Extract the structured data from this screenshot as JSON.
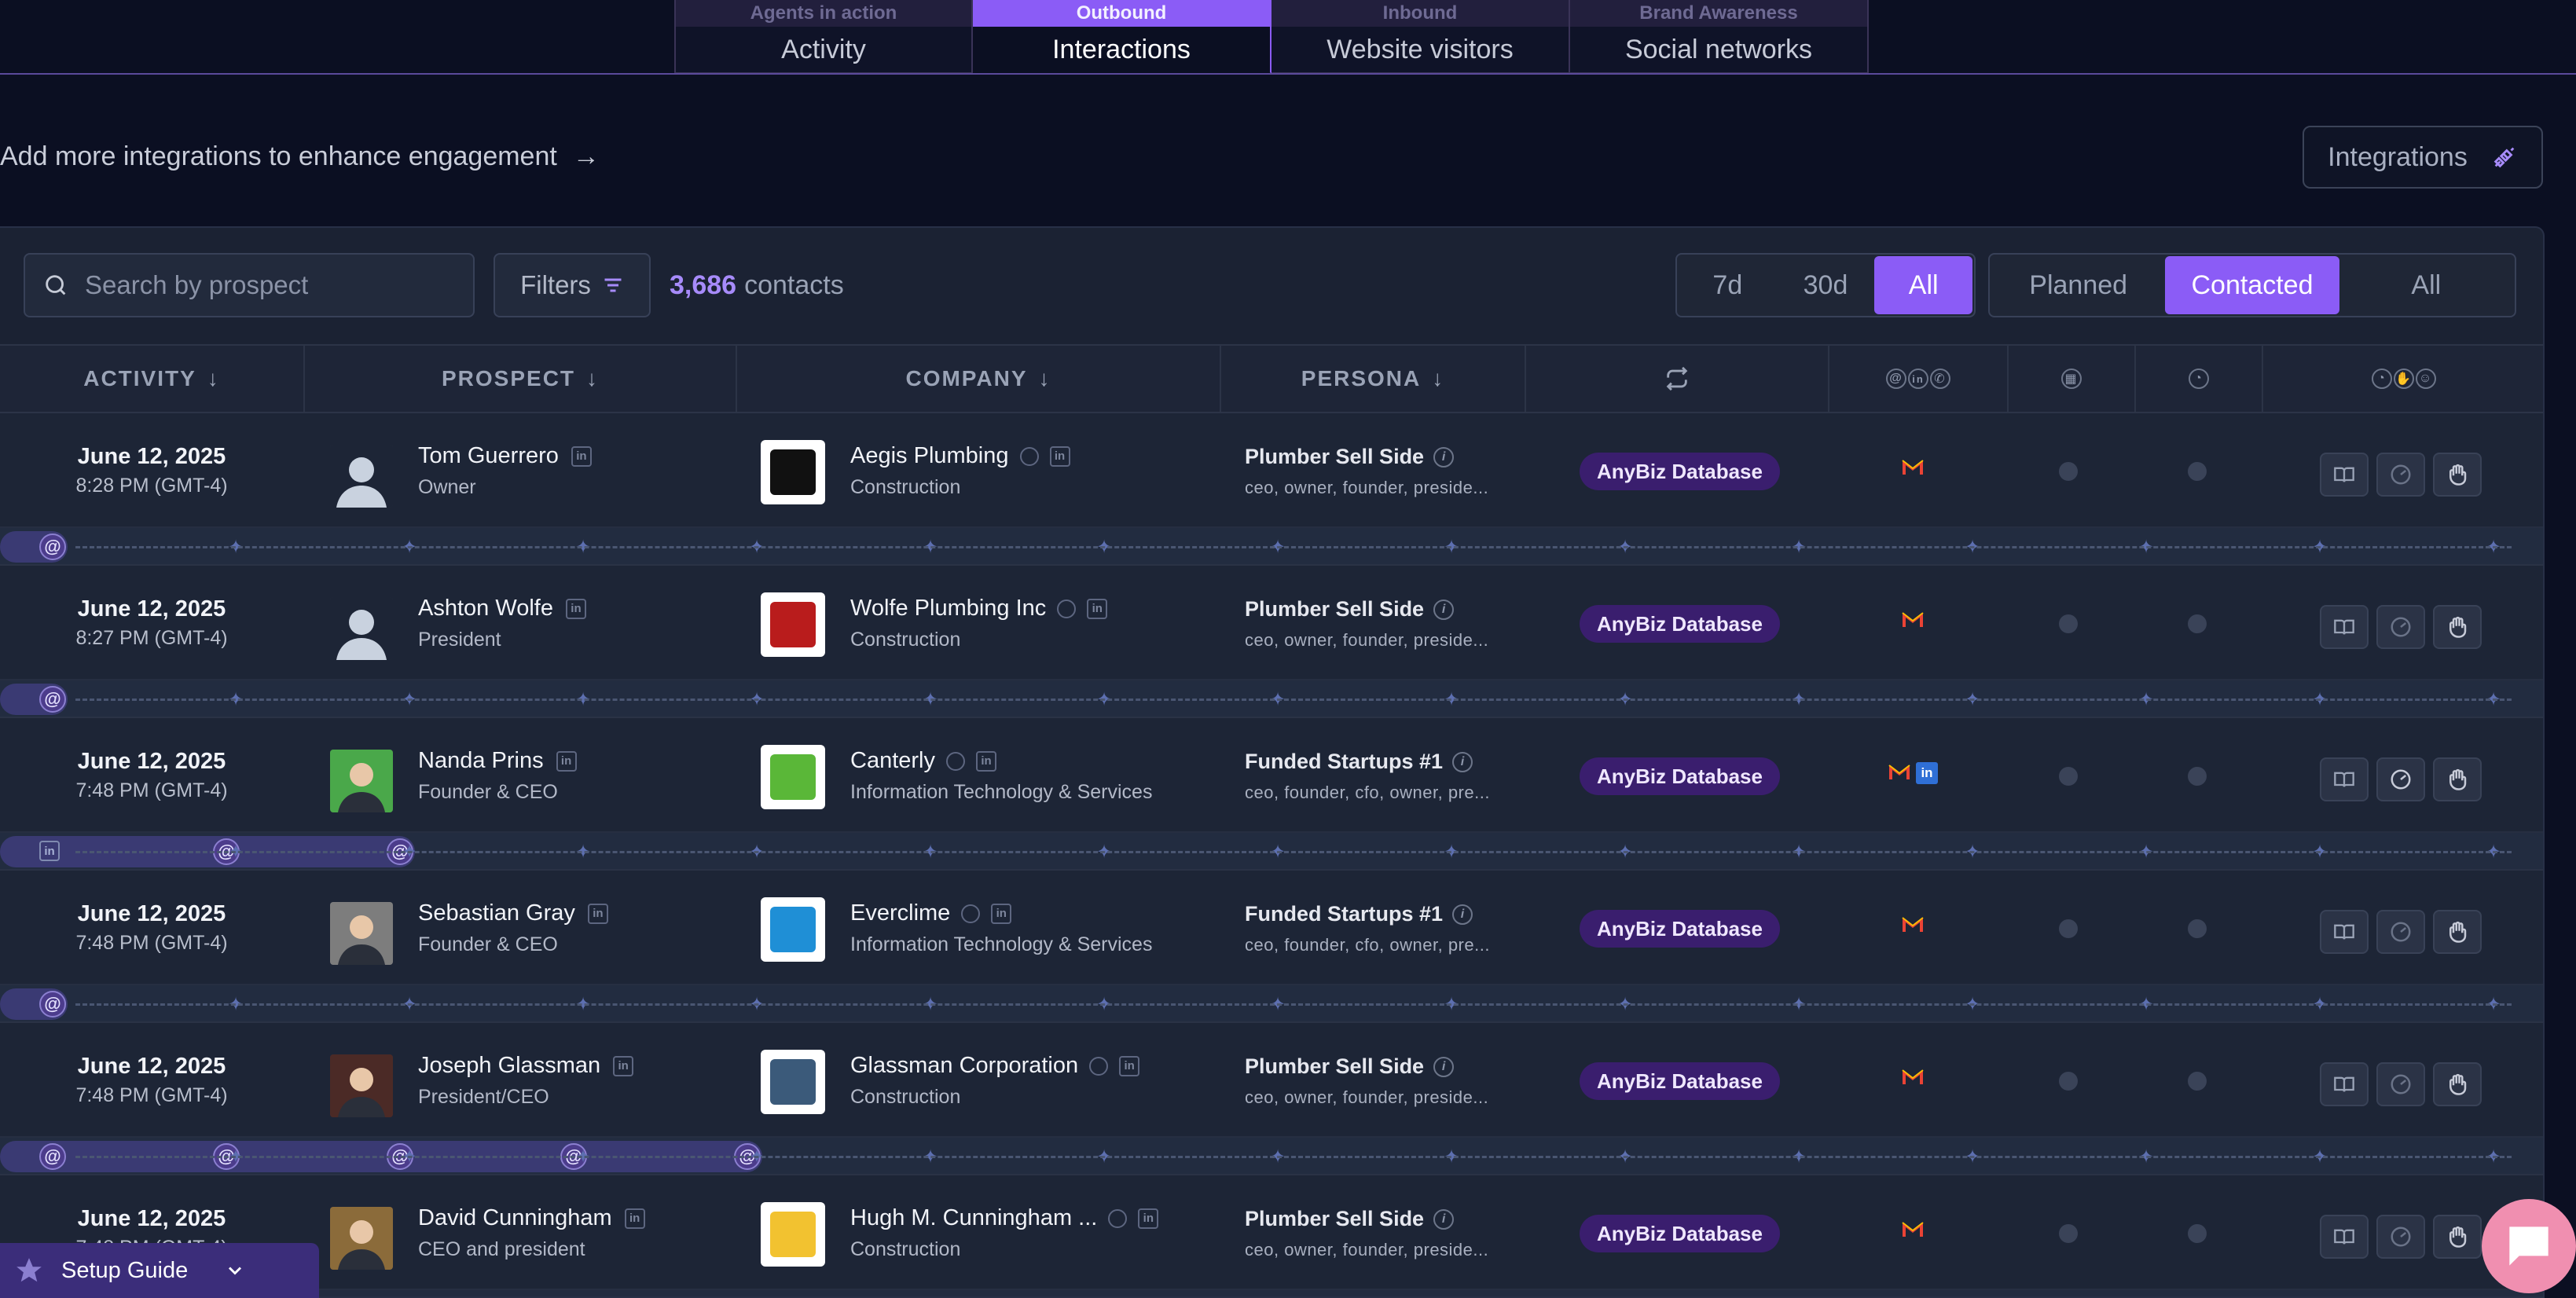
{
  "top_tabs": [
    {
      "caption": "Agents in action",
      "label": "Activity",
      "active": false
    },
    {
      "caption": "Outbound",
      "label": "Interactions",
      "active": true
    },
    {
      "caption": "Inbound",
      "label": "Website visitors",
      "active": false
    },
    {
      "caption": "Brand Awareness",
      "label": "Social networks",
      "active": false
    }
  ],
  "promo": {
    "text": "Add more integrations to enhance engagement",
    "arrow": "→"
  },
  "integrations_label": "Integrations",
  "search": {
    "placeholder": "Search by prospect"
  },
  "filters_label": "Filters",
  "contacts": {
    "count": "3,686",
    "label": "contacts"
  },
  "range_options": [
    "7d",
    "30d",
    "All"
  ],
  "range_selected": "All",
  "status_options": [
    "Planned",
    "Contacted",
    "All"
  ],
  "status_selected": "Contacted",
  "columns": {
    "activity": "ACTIVITY",
    "prospect": "PROSPECT",
    "company": "COMPANY",
    "persona": "PERSONA"
  },
  "colors": {
    "accent": "#8b5cf6",
    "badge": "#3a1e6e",
    "gmail_red": "#ea4335",
    "linkedin": "#2f6fd6"
  },
  "rows": [
    {
      "date": "June 12, 2025",
      "time": "8:28 PM (GMT-4)",
      "name": "Tom Guerrero",
      "role": "Owner",
      "company": "Aegis Plumbing",
      "industry": "Construction",
      "persona": "Plumber Sell Side",
      "tags": "ceo, owner, founder, preside...",
      "source": "AnyBiz Database",
      "channels": [
        "gmail"
      ]
    },
    {
      "date": "June 12, 2025",
      "time": "8:27 PM (GMT-4)",
      "name": "Ashton Wolfe",
      "role": "President",
      "company": "Wolfe Plumbing Inc",
      "industry": "Construction",
      "persona": "Plumber Sell Side",
      "tags": "ceo, owner, founder, preside...",
      "source": "AnyBiz Database",
      "channels": [
        "gmail"
      ]
    },
    {
      "date": "June 12, 2025",
      "time": "7:48 PM (GMT-4)",
      "name": "Nanda Prins",
      "role": "Founder & CEO",
      "company": "Canterly",
      "industry": "Information Technology & Services",
      "persona": "Funded Startups #1",
      "tags": "ceo, founder, cfo, owner, pre...",
      "source": "AnyBiz Database",
      "channels": [
        "gmail",
        "linkedin"
      ]
    },
    {
      "date": "June 12, 2025",
      "time": "7:48 PM (GMT-4)",
      "name": "Sebastian Gray",
      "role": "Founder & CEO",
      "company": "Everclime",
      "industry": "Information Technology & Services",
      "persona": "Funded Startups #1",
      "tags": "ceo, founder, cfo, owner, pre...",
      "source": "AnyBiz Database",
      "channels": [
        "gmail"
      ]
    },
    {
      "date": "June 12, 2025",
      "time": "7:48 PM (GMT-4)",
      "name": "Joseph Glassman",
      "role": "President/CEO",
      "company": "Glassman Corporation",
      "industry": "Construction",
      "persona": "Plumber Sell Side",
      "tags": "ceo, owner, founder, preside...",
      "source": "AnyBiz Database",
      "channels": [
        "gmail"
      ]
    },
    {
      "date": "June 12, 2025",
      "time": "7:48 PM (GMT-4)",
      "name": "David Cunningham",
      "role": "CEO and president",
      "company": "Hugh M. Cunningham ...",
      "industry": "Construction",
      "persona": "Plumber Sell Side",
      "tags": "ceo, owner, founder, preside...",
      "source": "AnyBiz Database",
      "channels": [
        "gmail"
      ]
    }
  ],
  "setup_guide": "Setup Guide"
}
